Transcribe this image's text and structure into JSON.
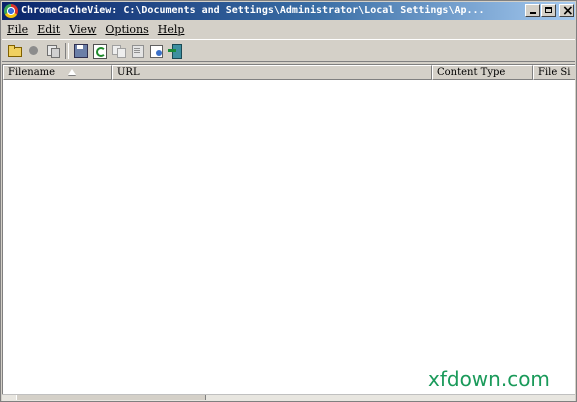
{
  "window": {
    "title": "ChromeCacheView:    C:\\Documents and Settings\\Administrator\\Local Settings\\Ap..."
  },
  "menu": {
    "items": [
      "File",
      "Edit",
      "View",
      "Options",
      "Help"
    ]
  },
  "toolbar": {
    "buttons": [
      "folder-icon",
      "stop-icon",
      "copy-files-icon",
      "save-icon",
      "refresh-icon",
      "copy-icon",
      "properties-icon",
      "html-report-icon",
      "exit-icon"
    ]
  },
  "list": {
    "columns": [
      "Filename",
      "URL",
      "Content Type",
      "File Si"
    ],
    "sorted_column": "Filename",
    "rows": []
  },
  "watermark": {
    "text": "xfdown.com",
    "color": "#1a9a5a"
  }
}
